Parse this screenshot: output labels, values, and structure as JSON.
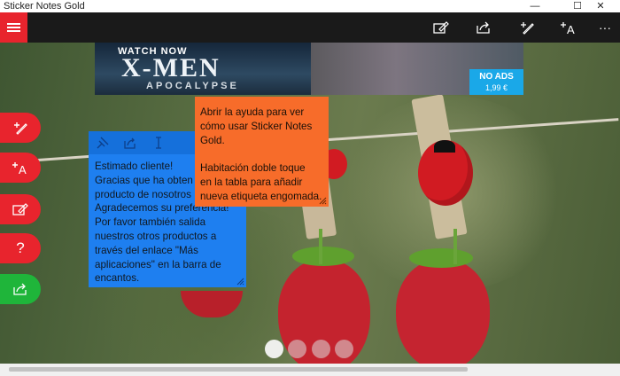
{
  "window": {
    "title": "Sticker Notes Gold",
    "controls": [
      "—",
      "☐",
      "✕"
    ]
  },
  "ad": {
    "watch_now": "WATCH NOW",
    "title": "X-MEN",
    "subtitle": "APOCALYPSE"
  },
  "no_ads": {
    "label": "NO ADS",
    "price": "1,99 €"
  },
  "note_blue": {
    "text": "Estimado cliente!\nGracias que ha obten\nproducto de nosotros\nAgradecemos su preferencia!\nPor favor también salida\nnuestros otros productos a\ntravés del enlace \"Más\naplicaciones\" en la barra de\nencantos.",
    "color": "#1e7ff0"
  },
  "note_orange": {
    "text": "Abrir la ayuda para ver\ncómo usar Sticker Notes\nGold.\n\nHabitación doble toque\nen la tabla para añadir\nnueva etiqueta engomada.",
    "color": "#f76c2a"
  },
  "toolbar_icons": [
    "edit-note-icon",
    "share-icon",
    "draw-icon",
    "add-text-icon",
    "more-icon"
  ],
  "side_buttons": [
    {
      "icon": "draw-icon",
      "color": "#e8242d"
    },
    {
      "icon": "add-text-icon",
      "color": "#e8242d"
    },
    {
      "icon": "edit-note-icon",
      "color": "#e8242d"
    },
    {
      "icon": "help-icon",
      "color": "#e8242d"
    },
    {
      "icon": "share-icon",
      "color": "#1fb53a"
    }
  ],
  "more_label": "···",
  "help_label": "?",
  "page_dots": {
    "count": 4,
    "active": 0
  },
  "accent": "#e8242d"
}
